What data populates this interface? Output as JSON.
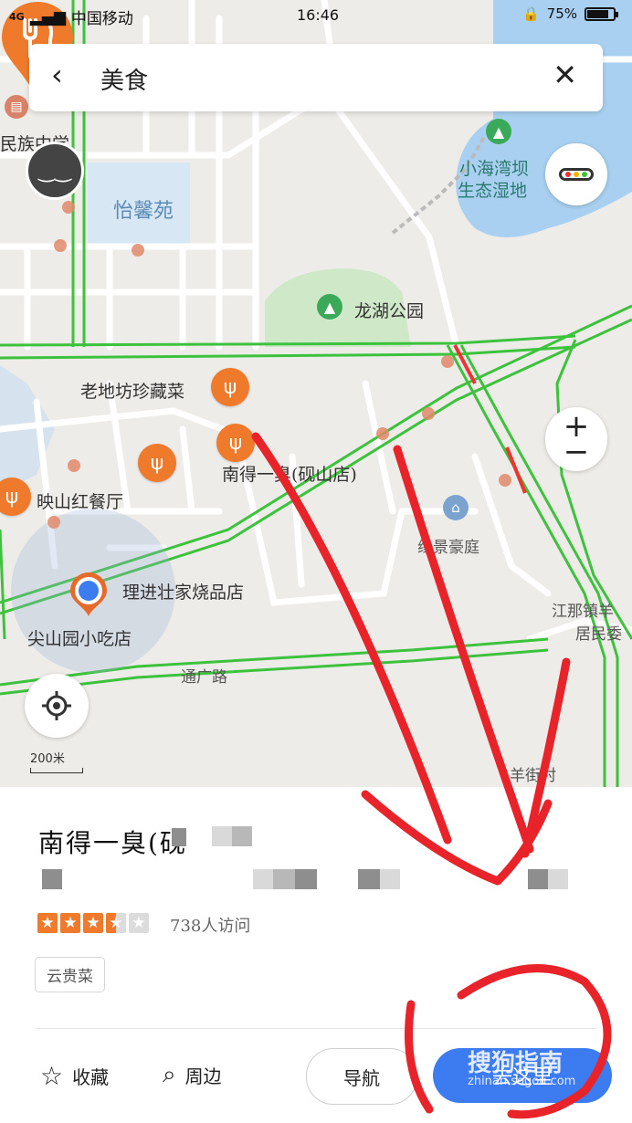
{
  "status_bar": {
    "signal": "4G",
    "carrier": "中国移动",
    "time": "16:46",
    "battery": "75%"
  },
  "search": {
    "query": "美食"
  },
  "map": {
    "labels": {
      "school": "民族中学",
      "garden": "怡馨苑",
      "wetland_line1": "小海湾坝",
      "wetland_line2": "生态湿地",
      "park": "龙湖公园",
      "collection": "老地坊珍藏菜",
      "restaurant_main": "南得一臭(砚山店)",
      "yingshan": "映山红餐厅",
      "lijin": "理进壮家烧品店",
      "jianshan": "尖山园小吃店",
      "jingjing": "缘景豪庭",
      "tongguang": "通广路",
      "jiangna_line1": "江那镇羊",
      "jiangna_line2": "居民委",
      "yangjie": "羊街村"
    },
    "scale": "200米"
  },
  "place": {
    "name": "南得一臭(砚",
    "rating": 3.5,
    "visits": "738人访问",
    "tag": "云贵菜"
  },
  "actions": {
    "favorite": "收藏",
    "nearby": "周边",
    "navigate": "导航",
    "go": "去这里"
  },
  "watermark": {
    "brand": "搜狗指南",
    "url": "zhinan.sogou.com"
  },
  "colors": {
    "road_green": "#3cc23c",
    "pin_orange": "#f07a2c",
    "go_blue": "#3d7bf0",
    "annotation_red": "#e8232a"
  }
}
